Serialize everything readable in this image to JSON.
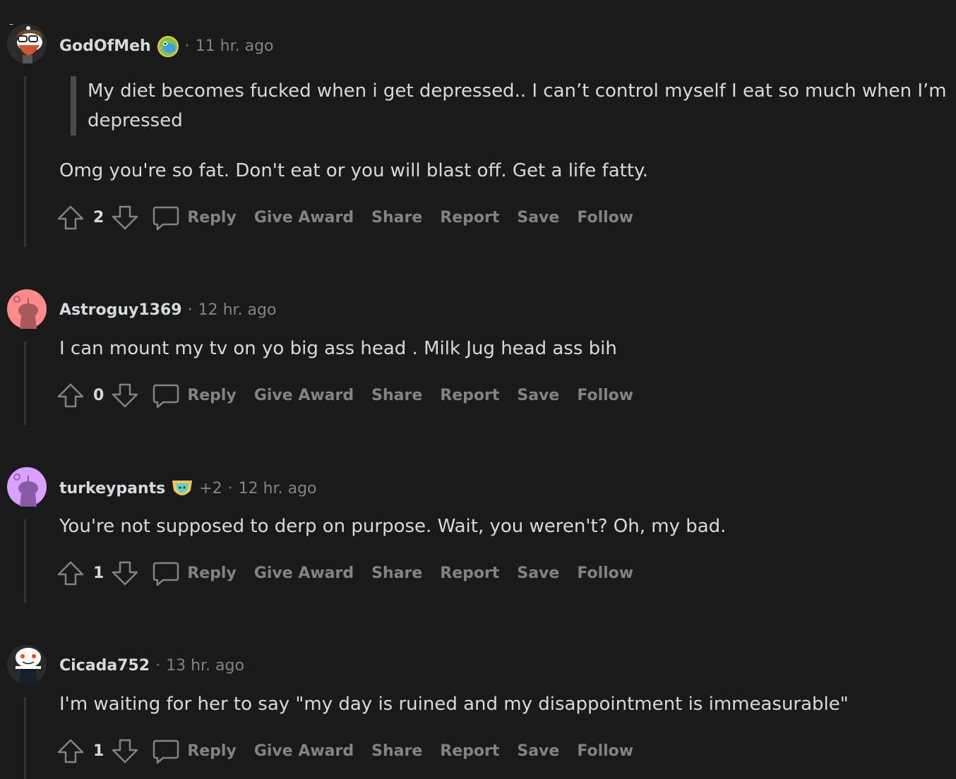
{
  "comments": [
    {
      "author": "GodOfMeh",
      "time": "11 hr. ago",
      "quote": "My diet becomes fucked when i get depressed.. I can’t control myself I eat so much when I’m depressed",
      "body": "Omg you're so fat. Don't eat or you will blast off. Get a life fatty.",
      "score": "2",
      "avatar_color": "#333333",
      "flair_icon": "parrot-icon"
    },
    {
      "author": "Astroguy1369",
      "time": "12 hr. ago",
      "body": "I can mount my tv on yo big ass head . Milk Jug head ass bih",
      "score": "0",
      "avatar_color": "#ff8a8a"
    },
    {
      "author": "turkeypants",
      "time": "12 hr. ago",
      "extra": "+2",
      "body": "You're not supposed to derp on purpose. Wait, you weren't? Oh, my bad.",
      "score": "1",
      "avatar_color": "#d9a0ff",
      "flair_icon": "cat-badge-icon"
    },
    {
      "author": "Cicada752",
      "time": "13 hr. ago",
      "body": "I'm waiting for her to say \"my day is ruined and my disappointment is immeasurable\"",
      "score": "1",
      "avatar_color": "#2a2a2a"
    }
  ],
  "actions": {
    "reply": "Reply",
    "give_award": "Give Award",
    "share": "Share",
    "report": "Report",
    "save": "Save",
    "follow": "Follow"
  },
  "separator": "·"
}
